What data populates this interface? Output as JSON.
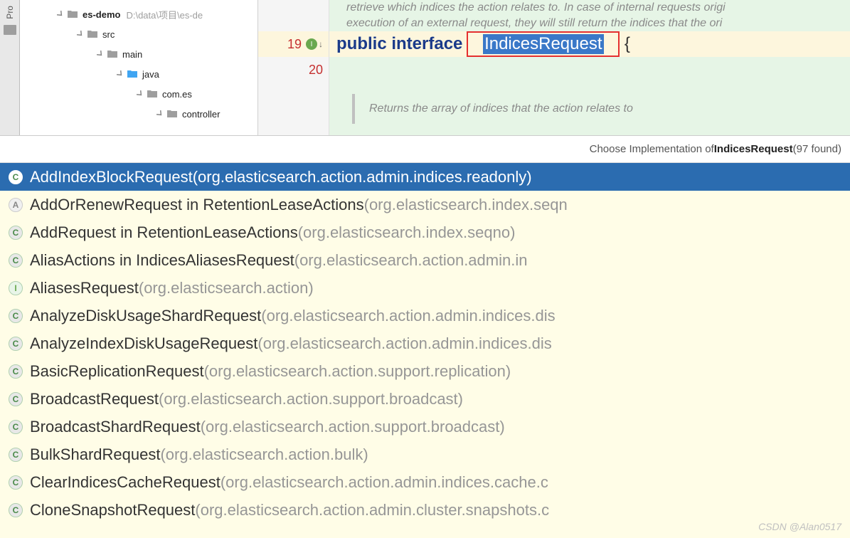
{
  "sidebar": {
    "tab_label": "Pro"
  },
  "tree": {
    "root": {
      "name": "es-demo",
      "path": "D:\\data\\项目\\es-de"
    },
    "nodes": [
      {
        "indent": 50,
        "name": "es-demo",
        "bold": true,
        "iconColor": "gray",
        "path": "D:\\data\\项目\\es-de",
        "expanded": true
      },
      {
        "indent": 78,
        "name": "src",
        "bold": false,
        "iconColor": "gray",
        "expanded": true
      },
      {
        "indent": 106,
        "name": "main",
        "bold": false,
        "iconColor": "gray",
        "expanded": true
      },
      {
        "indent": 134,
        "name": "java",
        "bold": false,
        "iconColor": "blue",
        "expanded": true
      },
      {
        "indent": 162,
        "name": "com.es",
        "bold": false,
        "iconColor": "gray",
        "expanded": true
      },
      {
        "indent": 190,
        "name": "controller",
        "bold": false,
        "iconColor": "gray",
        "expanded": true
      }
    ]
  },
  "editor": {
    "comment_top_1": "retrieve which indices the action relates to. In case of internal requests origi",
    "comment_top_2": "execution of an external request, they will still return the indices that the ori",
    "lines": [
      {
        "num": "19",
        "current": true,
        "hasImpl": true
      },
      {
        "num": "20",
        "current": false,
        "hasImpl": false
      }
    ],
    "kw_public": "public",
    "kw_interface": "interface",
    "class_name": "IndicesRequest",
    "brace": "{",
    "doc_returns": "Returns the array of indices that the action relates to"
  },
  "popup": {
    "title_prefix": "Choose Implementation of ",
    "title_class": "IndicesRequest",
    "title_count": " (97 found)",
    "results": [
      {
        "icon": "c",
        "name": "AddIndexBlockRequest ",
        "pkg": "(org.elasticsearch.action.admin.indices.readonly)",
        "selected": true
      },
      {
        "icon": "a",
        "name": "AddOrRenewRequest in RetentionLeaseActions ",
        "pkg": "(org.elasticsearch.index.seqn"
      },
      {
        "icon": "c",
        "name": "AddRequest in RetentionLeaseActions ",
        "pkg": "(org.elasticsearch.index.seqno)"
      },
      {
        "icon": "c",
        "name": "AliasActions in IndicesAliasesRequest ",
        "pkg": "(org.elasticsearch.action.admin.in"
      },
      {
        "icon": "i",
        "name": "AliasesRequest ",
        "pkg": "(org.elasticsearch.action)"
      },
      {
        "icon": "c",
        "name": "AnalyzeDiskUsageShardRequest ",
        "pkg": "(org.elasticsearch.action.admin.indices.dis"
      },
      {
        "icon": "c",
        "name": "AnalyzeIndexDiskUsageRequest ",
        "pkg": "(org.elasticsearch.action.admin.indices.dis"
      },
      {
        "icon": "c",
        "name": "BasicReplicationRequest ",
        "pkg": "(org.elasticsearch.action.support.replication)"
      },
      {
        "icon": "c",
        "name": "BroadcastRequest ",
        "pkg": "(org.elasticsearch.action.support.broadcast)"
      },
      {
        "icon": "c",
        "name": "BroadcastShardRequest ",
        "pkg": "(org.elasticsearch.action.support.broadcast)"
      },
      {
        "icon": "c",
        "name": "BulkShardRequest ",
        "pkg": "(org.elasticsearch.action.bulk)"
      },
      {
        "icon": "c",
        "name": "ClearIndicesCacheRequest ",
        "pkg": "(org.elasticsearch.action.admin.indices.cache.c"
      },
      {
        "icon": "c",
        "name": "CloneSnapshotRequest ",
        "pkg": "(org.elasticsearch.action.admin.cluster.snapshots.c"
      }
    ]
  },
  "watermark": "CSDN @Alan0517"
}
